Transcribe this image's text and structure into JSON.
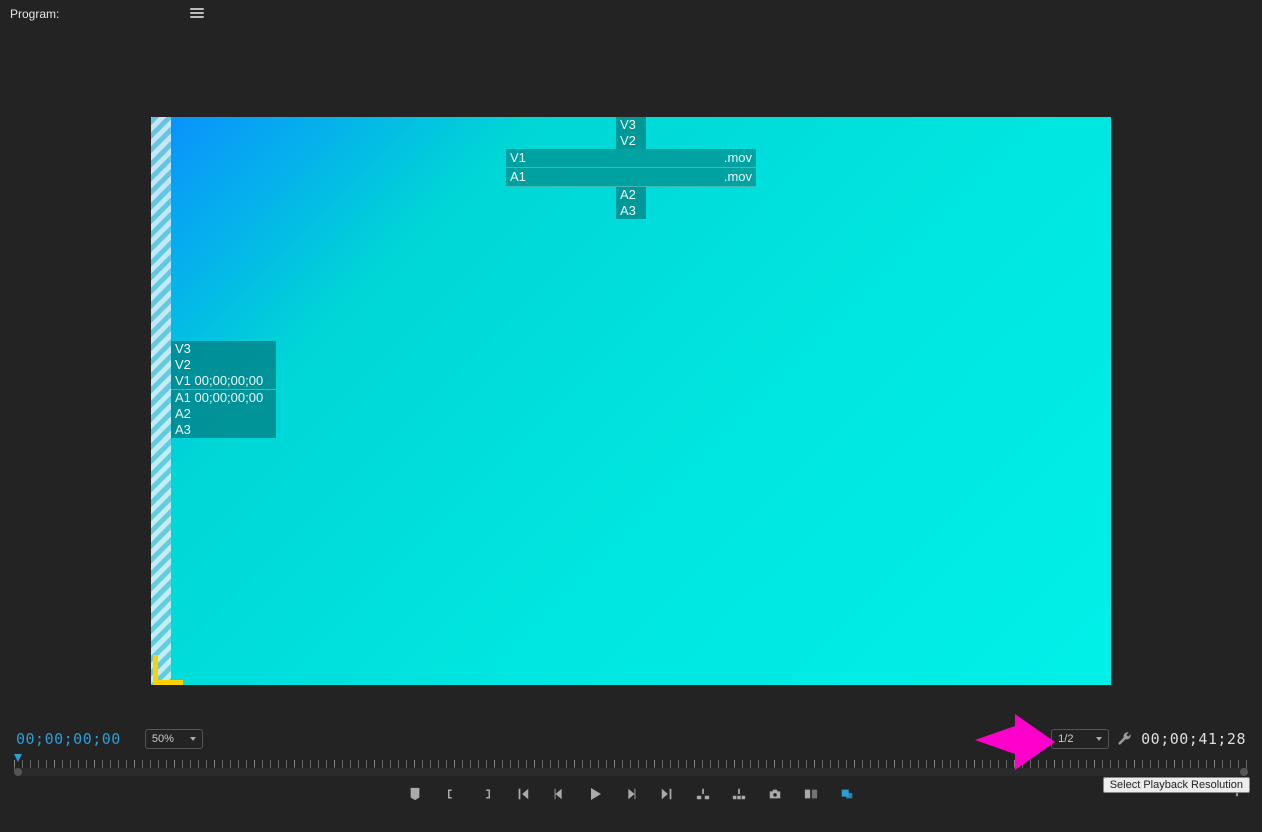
{
  "header": {
    "title_prefix": "Program:",
    "title_sequence": ""
  },
  "viewer": {
    "top_indicator": {
      "v3": "V3",
      "v2": "V2",
      "v1_label": "V1",
      "v1_ext": ".mov",
      "a1_label": "A1",
      "a1_ext": ".mov",
      "a2": "A2",
      "a3": "A3"
    },
    "left_indicator": {
      "v3": "V3",
      "v2": "V2",
      "v1": "V1 00;00;00;00",
      "a1": "A1 00;00;00;00",
      "a2": "A2",
      "a3": "A3"
    }
  },
  "controls": {
    "current_timecode": "00;00;00;00",
    "zoom": "50%",
    "playback_resolution": "1/2",
    "duration_timecode": "00;00;41;28",
    "tooltip": "Select Playback Resolution"
  },
  "colors": {
    "accent": "#2a9fd6",
    "annotation": "#ff00cc"
  }
}
